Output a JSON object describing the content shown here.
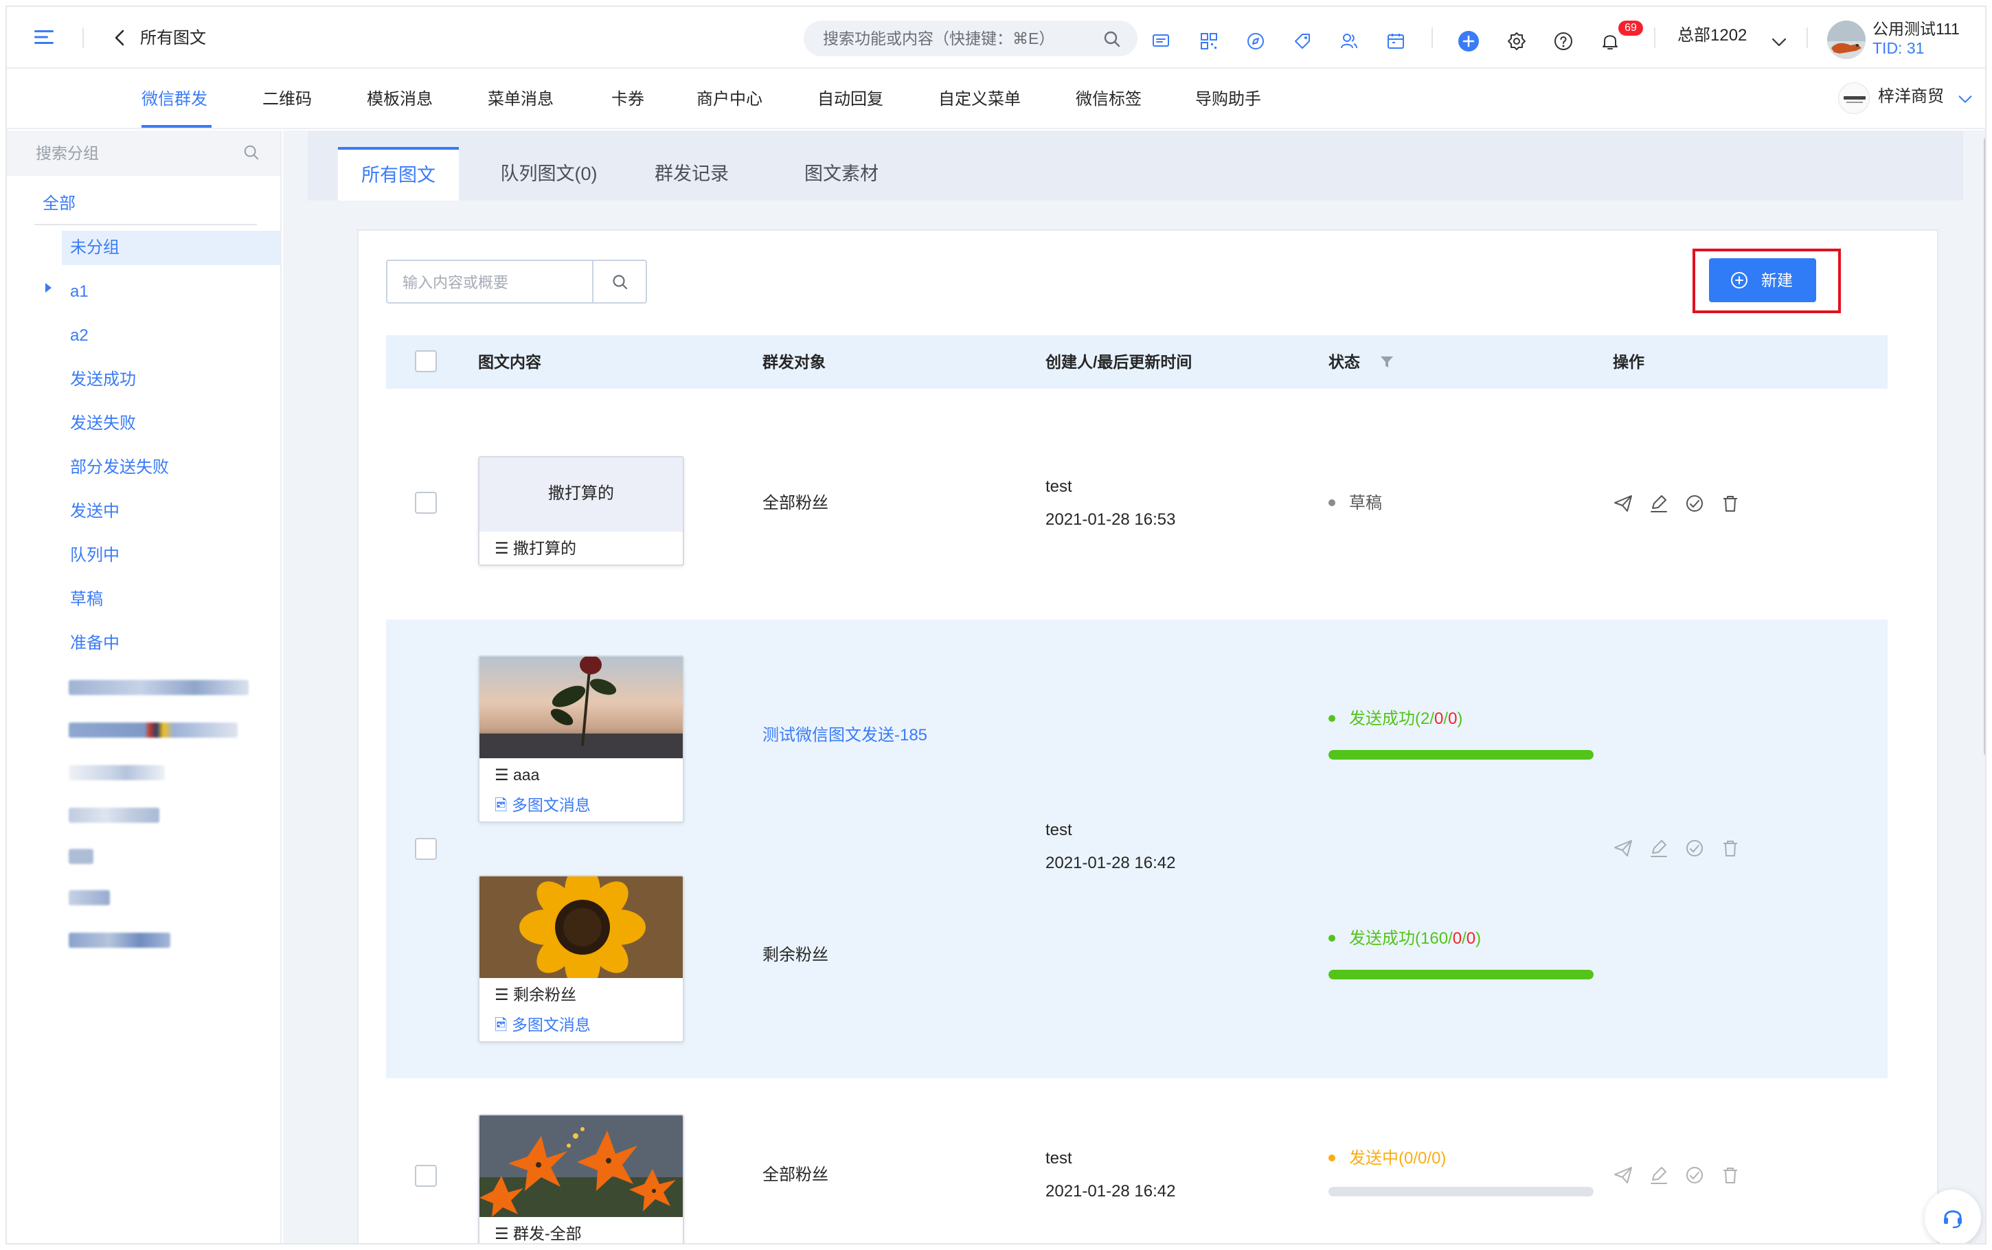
{
  "header": {
    "title": "所有图文",
    "search_placeholder": "搜索功能或内容（快捷键：⌘E）",
    "notification_count": "69",
    "account": "总部1202",
    "user_name": "公用测试111",
    "user_tid": "TID: 31"
  },
  "nav": {
    "items": [
      "微信群发",
      "二维码",
      "模板消息",
      "菜单消息",
      "卡券",
      "商户中心",
      "自动回复",
      "自定义菜单",
      "微信标签",
      "导购助手"
    ],
    "active": "微信群发",
    "brand": "梓洋商贸"
  },
  "sidebar": {
    "search_placeholder": "搜索分组",
    "all_label": "全部",
    "groups": [
      "未分组",
      "a1",
      "a2",
      "发送成功",
      "发送失败",
      "部分发送失败",
      "发送中",
      "队列中",
      "草稿",
      "准备中"
    ],
    "selected": "未分组"
  },
  "tabs": {
    "items": [
      "所有图文",
      "队列图文(0)",
      "群发记录",
      "图文素材"
    ],
    "active": "所有图文"
  },
  "toolbar": {
    "search_placeholder": "输入内容或概要",
    "new_label": "新建"
  },
  "table": {
    "columns": [
      "图文内容",
      "群发对象",
      "创建人/最后更新时间",
      "状态",
      "操作"
    ],
    "rows": [
      {
        "card_title": "撒打算的",
        "card_item": "撒打算的",
        "target": "全部粉丝",
        "creator": "test",
        "time": "2021-01-28 16:53",
        "status": "草稿"
      },
      {
        "creator": "test",
        "time": "2021-01-28 16:42",
        "sub": [
          {
            "card_item": "aaa",
            "card_type": "多图文消息",
            "target": "测试微信图文发送-185",
            "status_label": "发送成功",
            "status_counts": [
              "2",
              "0",
              "0"
            ],
            "progress": 1.0
          },
          {
            "card_item": "剩余粉丝",
            "card_type": "多图文消息",
            "target": "剩余粉丝",
            "status_label": "发送成功",
            "status_counts": [
              "160",
              "0",
              "0"
            ],
            "progress": 1.0
          }
        ]
      },
      {
        "card_item": "群发-全部",
        "target": "全部粉丝",
        "creator": "test",
        "time": "2021-01-28 16:42",
        "status_label": "发送中",
        "status_counts": [
          "0",
          "0",
          "0"
        ],
        "progress": 0.0
      }
    ]
  },
  "colors": {
    "primary": "#3a7bf7",
    "success": "#52c41a",
    "warning": "#faad14",
    "danger": "#f5222d",
    "highlight_border": "#e0121f"
  },
  "icons": [
    "menu-icon",
    "back-icon",
    "search-icon",
    "message-icon",
    "qrcode-icon",
    "compass-icon",
    "tag-icon",
    "users-icon",
    "calendar-icon",
    "plus-circle-icon",
    "gear-icon",
    "help-icon",
    "bell-icon",
    "chevron-down-icon",
    "send-icon",
    "edit-icon",
    "sync-icon",
    "trash-icon",
    "list-icon",
    "image-icon",
    "filter-icon",
    "headset-icon"
  ]
}
